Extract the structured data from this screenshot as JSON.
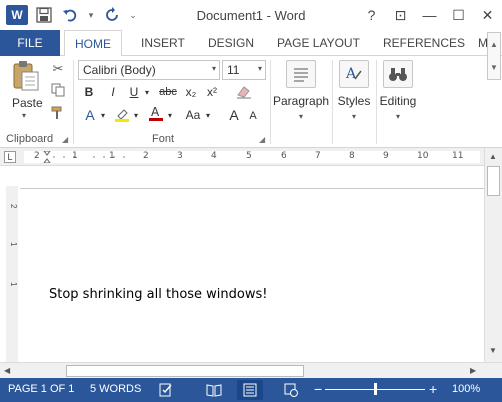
{
  "window": {
    "title": "Document1 - Word",
    "help": "?",
    "controls": {
      "ribbon_display": "⊡",
      "minimize": "—",
      "maximize": "☐",
      "close": "✕"
    }
  },
  "quick_access": {
    "logo": "W",
    "save_icon": "save-icon",
    "undo_icon": "undo-icon",
    "redo_icon": "redo-icon",
    "dropdown": "▾",
    "customize": "⌄"
  },
  "tabs": {
    "file": "FILE",
    "items": [
      "HOME",
      "INSERT",
      "DESIGN",
      "PAGE LAYOUT",
      "REFERENCES",
      "M"
    ],
    "active": "HOME"
  },
  "ribbon": {
    "clipboard": {
      "label": "Clipboard",
      "paste": "Paste"
    },
    "font": {
      "label": "Font",
      "name": "Calibri (Body)",
      "size": "11",
      "bold": "B",
      "italic": "I",
      "underline": "U",
      "strikethrough": "abc",
      "subscript": "x₂",
      "superscript": "x²",
      "text_effects": "A",
      "change_case": "Aa",
      "grow": "A",
      "shrink": "A"
    },
    "paragraph": {
      "label": "Paragraph"
    },
    "styles": {
      "label": "Styles"
    },
    "editing": {
      "label": "Editing"
    }
  },
  "ruler": {
    "numbers": [
      "2",
      "1",
      "1",
      "2",
      "3",
      "4",
      "5",
      "6",
      "7",
      "8",
      "9",
      "10",
      "11"
    ],
    "vertical_numbers": [
      "2",
      "1",
      "1"
    ],
    "corner": "L"
  },
  "document": {
    "text": "Stop shrinking all those windows!"
  },
  "status": {
    "page": "PAGE 1 OF 1",
    "words": "5 WORDS",
    "zoom": "100%",
    "zoom_level": 1.0,
    "zoom_minus": "−",
    "zoom_plus": "+"
  },
  "colors": {
    "accent": "#2b579a",
    "title_text": "#444444"
  }
}
